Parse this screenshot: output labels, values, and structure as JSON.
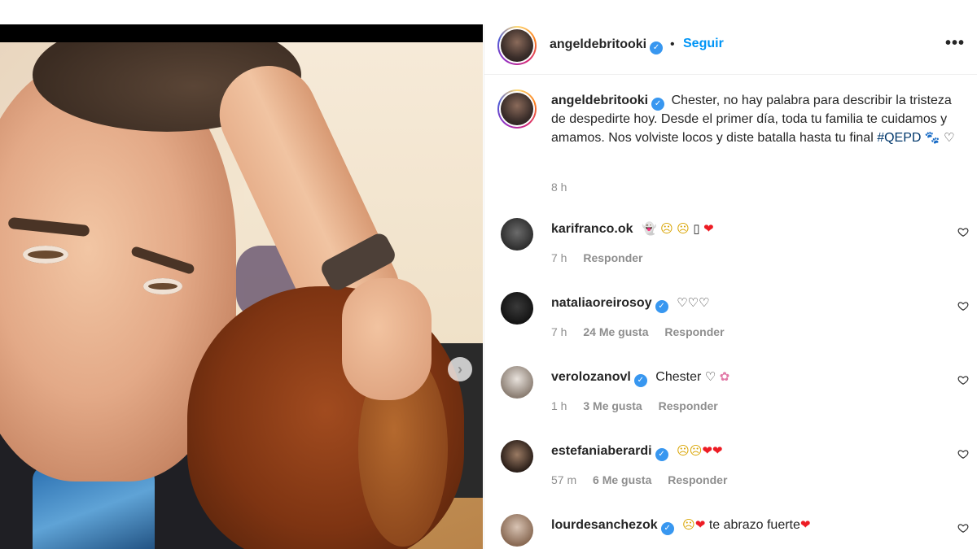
{
  "post": {
    "username": "angeldebritooki",
    "verified_mark": "✓",
    "follow_label": "Seguir",
    "separator": "•",
    "more_label": "•••",
    "caption_text": "Chester, no hay palabra para describir la tristeza de despedirte hoy. Desde el primer día, toda tu familia te cuidamos y amamos. Nos volviste locos y diste batalla hasta tu final",
    "hashtag": "#QEPD",
    "caption_emojis": [
      "🐾",
      "♡"
    ],
    "time": "8 h",
    "carousel_next_label": "›"
  },
  "comments": [
    {
      "username": "karifranco.ok",
      "verified": false,
      "text": "",
      "emojis": [
        "👻",
        "☹",
        "☹",
        "▯",
        "❤"
      ],
      "time": "7 h",
      "likes": "",
      "reply_label": "Responder"
    },
    {
      "username": "nataliaoreirosoy",
      "verified": true,
      "text": "",
      "emojis": [
        "♡",
        "♡",
        "♡"
      ],
      "time": "7 h",
      "likes": "24 Me gusta",
      "reply_label": "Responder"
    },
    {
      "username": "verolozanovl",
      "verified": true,
      "text": "Chester",
      "emojis": [
        "♡",
        "✿"
      ],
      "time": "1 h",
      "likes": "3 Me gusta",
      "reply_label": "Responder"
    },
    {
      "username": "estefaniaberardi",
      "verified": true,
      "text": "",
      "emojis": [
        "☹",
        "☹",
        "❤",
        "❤"
      ],
      "time": "57 m",
      "likes": "6 Me gusta",
      "reply_label": "Responder"
    },
    {
      "username": "lourdesanchezok",
      "verified": true,
      "text": "te abrazo fuerte",
      "emojis": [
        "☹",
        "❤"
      ],
      "trailing_emoji": "❤",
      "time": "",
      "likes": "",
      "reply_label": ""
    }
  ],
  "icons": {
    "like": "heart-outline-icon",
    "next": "chevron-right-icon",
    "more": "more-options-icon",
    "verified": "verified-badge-icon"
  },
  "colors": {
    "link_blue": "#0095f6",
    "verified_blue": "#3897f0",
    "hashtag": "#00376b",
    "muted": "#8e8e8e",
    "text": "#262626"
  }
}
